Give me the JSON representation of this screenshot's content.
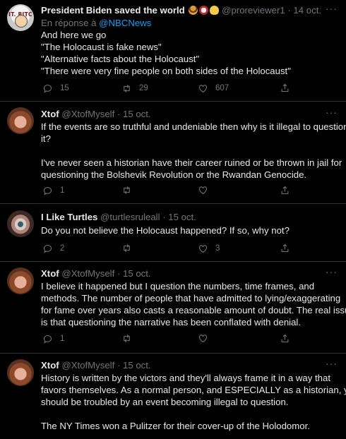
{
  "tweets": [
    {
      "name": "President Biden saved the world",
      "emojis": [
        "burger-emoji",
        "drum-emoji",
        "yellow-heart-emoji"
      ],
      "handle": "@proreviewer1",
      "date": "· 14 oct.",
      "replying_prefix": "En réponse à",
      "replying_to": "@NBCNews",
      "avatar_text": "IT. BITC",
      "lines": [
        "And here we go",
        "\"The Holocaust is fake news\"",
        "\"Alternative facts about the Holocaust\"",
        "\"There were very fine people on both sides of the Holocaust\""
      ],
      "replies": "15",
      "retweets": "29",
      "likes": "607"
    },
    {
      "name": "Xtof",
      "handle": "@XtofMyself",
      "date": "· 15 oct.",
      "lines": [
        "If the events are so truthful and undeniable then why is it illegal to question",
        "it?",
        "",
        "I've never seen a historian have their career ruined or be thrown in jail for",
        "questioning the Bolshevik Revolution or the Rwandan Genocide."
      ],
      "replies": "1",
      "retweets": "",
      "likes": ""
    },
    {
      "name": "I Like Turtles",
      "handle": "@turtlesruleall",
      "date": "· 15 oct.",
      "lines": [
        "Do you not believe the Holocaust happened? If so, why not?"
      ],
      "replies": "2",
      "retweets": "",
      "likes": "3"
    },
    {
      "name": "Xtof",
      "handle": "@XtofMyself",
      "date": "· 15 oct.",
      "lines": [
        "I believe it happened but I question the numbers, time frames, and",
        "methods. The number of people that have admitted to lying/exaggerating",
        "for fame over years also casts a reasonable amount of doubt. The real issue",
        "is that questioning the narrative has been conflated with denial."
      ],
      "replies": "1",
      "retweets": "",
      "likes": ""
    },
    {
      "name": "Xtof",
      "handle": "@XtofMyself",
      "date": "· 15 oct.",
      "lines": [
        "History is written by the victors and they'll always frame it in a way that",
        "favors themselves. As a normal person, and ESPECIALLY as a historian, you",
        "should be troubled by an event becoming illegal to question.",
        "",
        "The NY Times won a Pulitzer for their cover-up of the Holodomor."
      ]
    }
  ],
  "more_label": "···",
  "colors": {
    "background": "#000000",
    "text": "#e7e9ea",
    "muted": "#71767b",
    "link": "#1d9bf0",
    "divider": "#2f3336"
  }
}
